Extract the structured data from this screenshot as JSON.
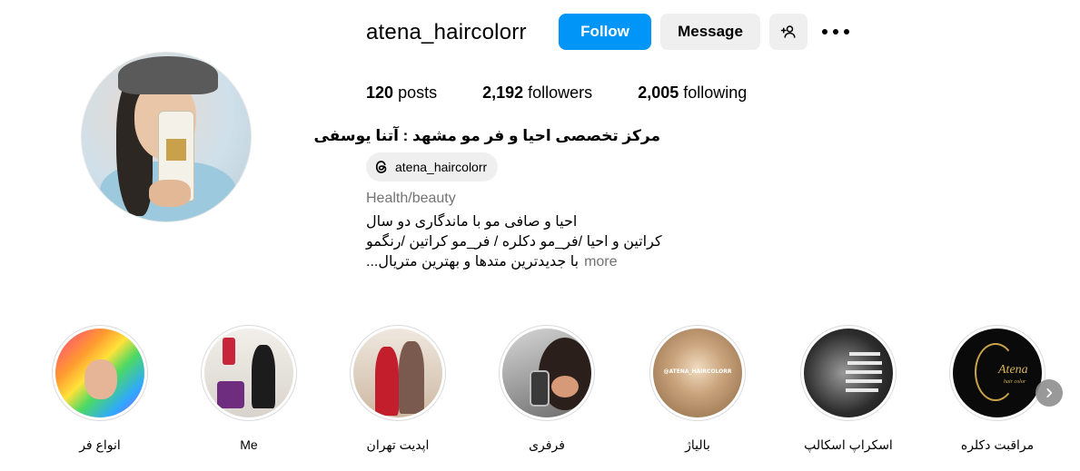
{
  "profile": {
    "username": "atena_haircolorr",
    "full_name": "مرکز تخصصی احیا و فر مو مشهد : آتنا یوسفی",
    "threads_handle": "atena_haircolorr",
    "category": "Health/beauty",
    "bio_lines": [
      "احیا و صافی مو با ماندگاری دو سال",
      "کراتین و احیا /فر_مو دکلره / فر_مو کراتین /رنگمو",
      "با جدیدترین متدها و بهترین متریال..."
    ],
    "more_label": "more"
  },
  "actions": {
    "follow_label": "Follow",
    "message_label": "Message",
    "add_user_icon": "add-person-icon",
    "more_icon": "more-options-icon"
  },
  "stats": {
    "posts_count": "120",
    "posts_label": "posts",
    "followers_count": "2,192",
    "followers_label": "followers",
    "following_count": "2,005",
    "following_label": "following"
  },
  "highlights": [
    {
      "label": "انواع فر"
    },
    {
      "label": "Me"
    },
    {
      "label": "اپدیت تهران"
    },
    {
      "label": "فرفری"
    },
    {
      "label": "بالیاژ"
    },
    {
      "label": "اسکراپ اسکالپ"
    },
    {
      "label": "مراقبت دکلره"
    }
  ],
  "highlight_image_text": {
    "balayage_watermark": "@ATENA_HAIRCOLORR",
    "logo_brand": "Atena",
    "logo_sub": "hair color"
  },
  "colors": {
    "follow_blue": "#0095f6",
    "button_gray": "#efefef",
    "muted_text": "#737373"
  }
}
